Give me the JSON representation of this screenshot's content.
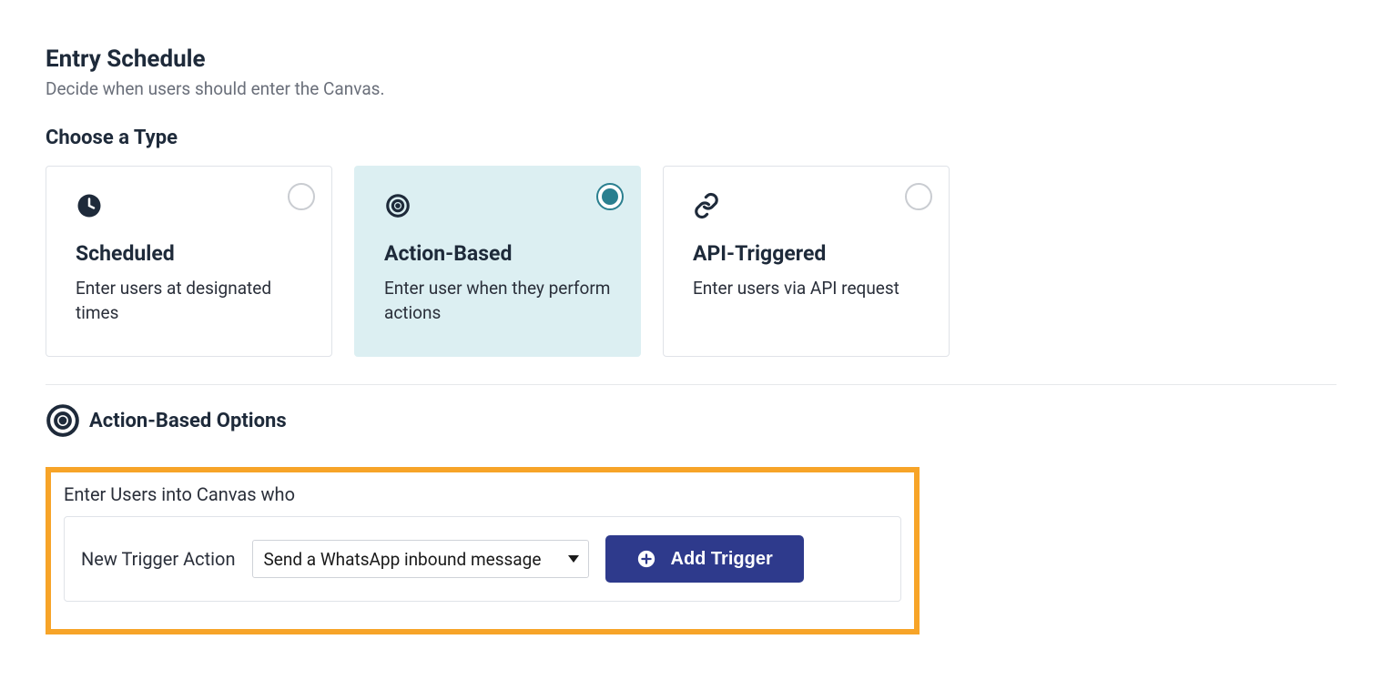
{
  "header": {
    "title": "Entry Schedule",
    "subtitle": "Decide when users should enter the Canvas."
  },
  "chooseType": {
    "label": "Choose a Type",
    "cards": [
      {
        "title": "Scheduled",
        "description": "Enter users at designated times",
        "icon": "clock",
        "selected": false
      },
      {
        "title": "Action-Based",
        "description": "Enter user when they perform actions",
        "icon": "target",
        "selected": true
      },
      {
        "title": "API-Triggered",
        "description": "Enter users via API request",
        "icon": "link",
        "selected": false
      }
    ]
  },
  "options": {
    "header": "Action-Based Options",
    "enterUsersLabel": "Enter Users into Canvas who",
    "triggerLabel": "New Trigger Action",
    "triggerSelectValue": "Send a WhatsApp inbound message",
    "addTriggerLabel": "Add Trigger"
  }
}
